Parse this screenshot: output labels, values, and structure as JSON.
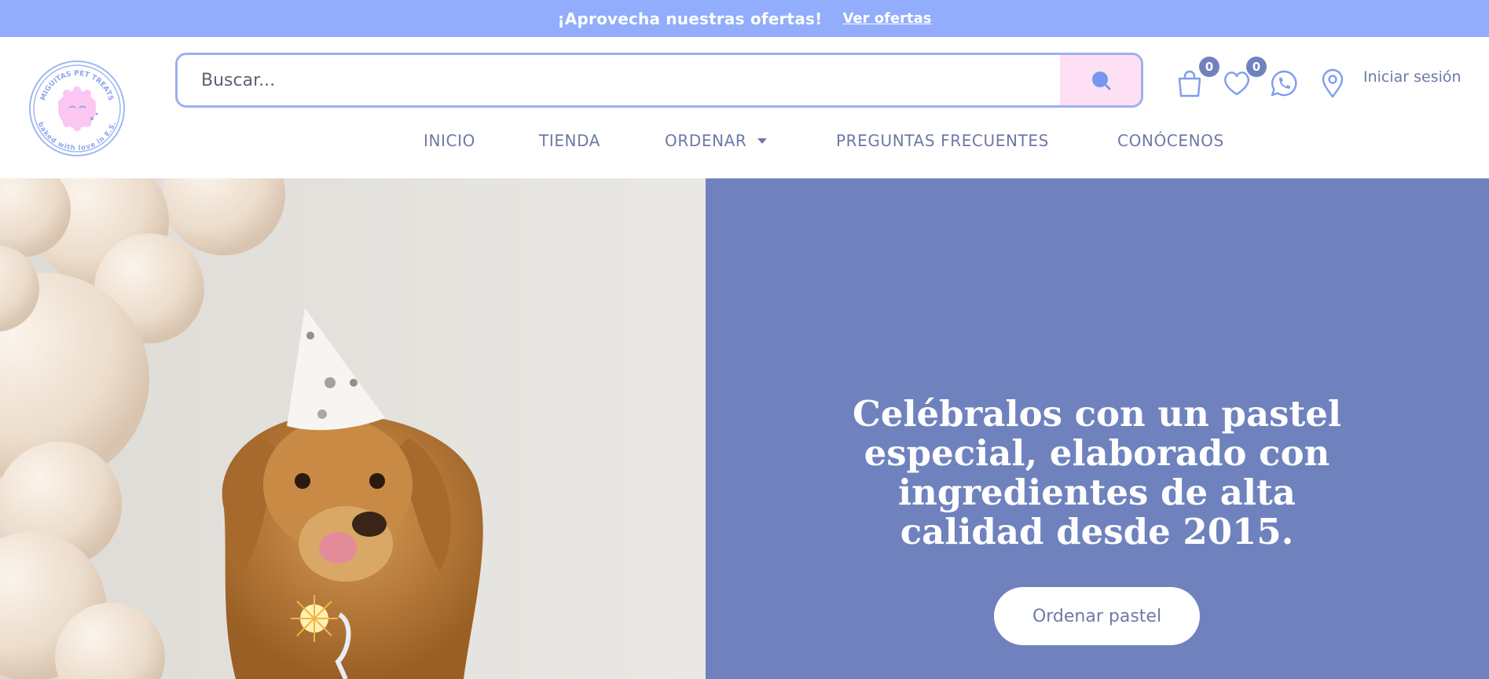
{
  "announcement": {
    "message": "¡Aprovecha nuestras ofertas!",
    "link_label": "Ver ofertas"
  },
  "header": {
    "logo": {
      "ring_text_top": "MIGUITAS PET TREATS",
      "ring_text_bottom": "baked with love in E.S."
    },
    "search": {
      "placeholder": "Buscar...",
      "button_icon": "search-icon"
    },
    "actions": {
      "cart": {
        "icon": "shopping-bag-icon",
        "count": "0"
      },
      "wishlist": {
        "icon": "heart-icon",
        "count": "0"
      },
      "whatsapp": {
        "icon": "whatsapp-icon"
      },
      "location": {
        "icon": "map-pin-icon"
      },
      "login_label": "Iniciar sesión"
    },
    "nav": [
      {
        "label": "INICIO"
      },
      {
        "label": "TIENDA"
      },
      {
        "label": "ORDENAR",
        "has_dropdown": true
      },
      {
        "label": "PREGUNTAS FRECUENTES"
      },
      {
        "label": "CONÓCENOS"
      }
    ]
  },
  "hero": {
    "title": "Celébralos con un pastel especial, elaborado con ingredientes de alta calidad desde 2015.",
    "cta_label": "Ordenar pastel"
  },
  "colors": {
    "announcement_bg": "#91adfb",
    "hero_panel_bg": "#6f82bd",
    "search_button_bg": "#fde0f4",
    "search_border": "#9fb0ee",
    "nav_text": "#6f79a6",
    "badge_bg": "#6f82bd"
  }
}
